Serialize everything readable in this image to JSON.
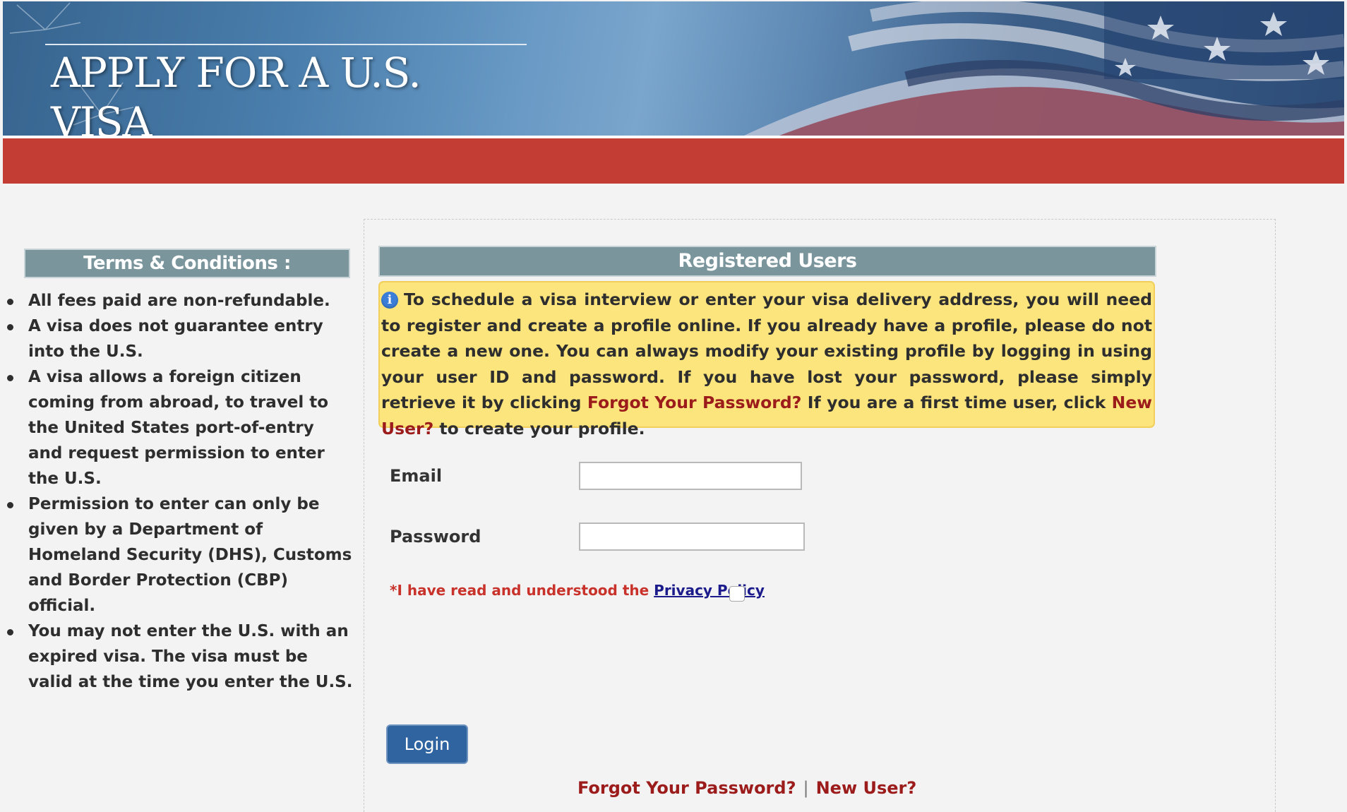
{
  "banner": {
    "title": "APPLY FOR A U.S. VISA"
  },
  "terms": {
    "header": "Terms & Conditions :",
    "items": [
      "All fees paid are non-refundable.",
      "A visa does not guarantee entry into the U.S.",
      "A visa allows a foreign citizen coming from abroad, to travel to the United States port-of-entry and request permission to enter the U.S.",
      "Permission to enter can only be given by a Department of Homeland Security (DHS), Customs and Border Protection (CBP) official.",
      "You may not enter the U.S. with an expired visa. The visa must be valid at the time you enter the U.S."
    ]
  },
  "registered": {
    "header": "Registered Users",
    "info_icon": "info-icon",
    "info_text_1": "To schedule a visa interview or enter your visa delivery address, you will need to register and create a profile online. If you already have a profile, please do not create a new one. You can always modify your existing profile by logging in using your user ID and password. If you have lost your password, please simply retrieve it by clicking ",
    "info_link_forgot": "Forgot Your Password?",
    "info_text_2": " If you are a first time user, click ",
    "info_link_new": "New User?",
    "info_text_3": " to create your profile."
  },
  "form": {
    "email_label": "Email",
    "email_value": "",
    "password_label": "Password",
    "password_value": "",
    "privacy_prefix": "*I have read and understood the ",
    "privacy_link": "Privacy Policy",
    "privacy_checked": false,
    "login_label": "Login"
  },
  "footer_links": {
    "forgot": "Forgot Your Password?",
    "separator": "|",
    "new_user": "New User?"
  },
  "colors": {
    "accent_red": "#c43d35",
    "header_gray_blue": "#7b959d",
    "info_yellow": "#fbe57c",
    "link_red": "#9c1b1b",
    "button_blue": "#2f64a0"
  }
}
